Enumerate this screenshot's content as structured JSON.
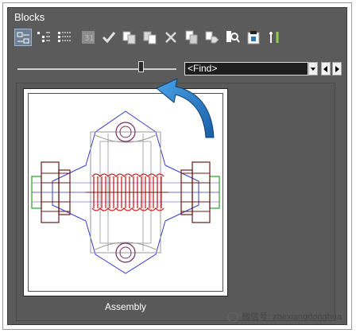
{
  "panel": {
    "title": "Blocks"
  },
  "toolbar": {
    "buttons": [
      {
        "name": "thumbnail-view-icon",
        "active": true
      },
      {
        "name": "tree-view-icon"
      },
      {
        "name": "list-view-icon"
      },
      {
        "name": "block-editor-icon"
      },
      {
        "name": "checkmark-icon"
      },
      {
        "name": "insert-block-icon"
      },
      {
        "name": "replace-block-icon"
      },
      {
        "name": "delete-icon"
      },
      {
        "name": "copy-block-icon"
      },
      {
        "name": "tag-icon"
      },
      {
        "name": "search-zoom-icon"
      },
      {
        "name": "clipboard-icon"
      },
      {
        "name": "tools-icon"
      }
    ]
  },
  "size_slider": {
    "level": 0.8
  },
  "find": {
    "value": "<Find>"
  },
  "gallery": {
    "items": [
      {
        "label": "Assembly",
        "selected": true
      }
    ]
  },
  "watermark": {
    "text": "微信号: zhexiangdonghua"
  }
}
